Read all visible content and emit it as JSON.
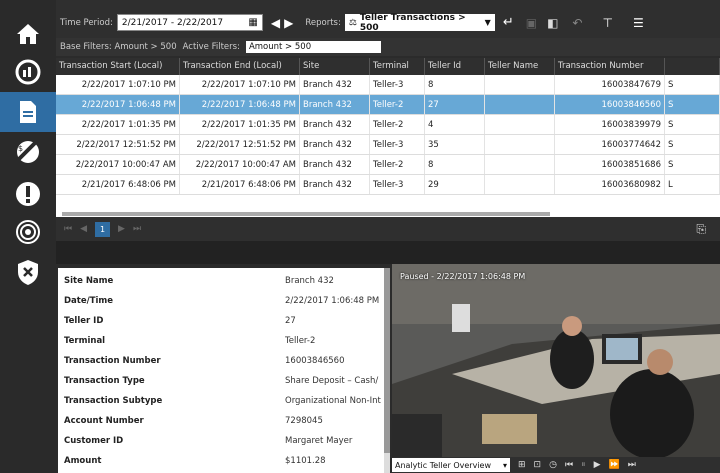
{
  "toolbar": {
    "time_period_label": "Time Period:",
    "time_period_value": "2/21/2017 - 2/22/2017",
    "reports_label": "Reports:",
    "report_value": "Teller Transactions > 500"
  },
  "filters": {
    "base_filters": "Base Filters: Amount > 500",
    "active_label": "Active Filters:",
    "active_value": "Amount > 500"
  },
  "grid": {
    "columns": [
      "Transaction Start (Local)",
      "Transaction End (Local)",
      "Site",
      "Terminal",
      "Teller Id",
      "Teller Name",
      "Transaction Number"
    ],
    "rows": [
      [
        "2/22/2017 1:07:10 PM",
        "2/22/2017 1:07:10 PM",
        "Branch 432",
        "Teller-3",
        "8",
        "",
        "16003847679",
        "S"
      ],
      [
        "2/22/2017 1:06:48 PM",
        "2/22/2017 1:06:48 PM",
        "Branch 432",
        "Teller-2",
        "27",
        "",
        "16003846560",
        "S"
      ],
      [
        "2/22/2017 1:01:35 PM",
        "2/22/2017 1:01:35 PM",
        "Branch 432",
        "Teller-2",
        "4",
        "",
        "16003839979",
        "S"
      ],
      [
        "2/22/2017 12:51:52 PM",
        "2/22/2017 12:51:52 PM",
        "Branch 432",
        "Teller-3",
        "35",
        "",
        "16003774642",
        "S"
      ],
      [
        "2/22/2017 10:00:47 AM",
        "2/22/2017 10:00:47 AM",
        "Branch 432",
        "Teller-2",
        "8",
        "",
        "16003851686",
        "S"
      ],
      [
        "2/21/2017 6:48:06 PM",
        "2/21/2017 6:48:06 PM",
        "Branch 432",
        "Teller-3",
        "29",
        "",
        "16003680982",
        "L"
      ]
    ]
  },
  "pager": {
    "page": "1"
  },
  "details": [
    {
      "label": "Site Name",
      "value": "Branch 432"
    },
    {
      "label": "Date/Time",
      "value": "2/22/2017 1:06:48 PM"
    },
    {
      "label": "Teller ID",
      "value": "27"
    },
    {
      "label": "Terminal",
      "value": "Teller-2"
    },
    {
      "label": "Transaction Number",
      "value": "16003846560"
    },
    {
      "label": "Transaction Type",
      "value": "Share Deposit – Cash/"
    },
    {
      "label": "Transaction Subtype",
      "value": "Organizational Non-Int"
    },
    {
      "label": "Account Number",
      "value": "7298045"
    },
    {
      "label": "Customer ID",
      "value": "Margaret Mayer"
    },
    {
      "label": "Amount",
      "value": "$1101.28"
    }
  ],
  "video": {
    "status": "Paused - 2/22/2017  1:06:48 PM",
    "layout": "Analytic Teller Overview"
  },
  "colors": {
    "accent": "#2f6da3",
    "selected_row": "#67a8d6",
    "chrome": "#2f2f2f"
  }
}
